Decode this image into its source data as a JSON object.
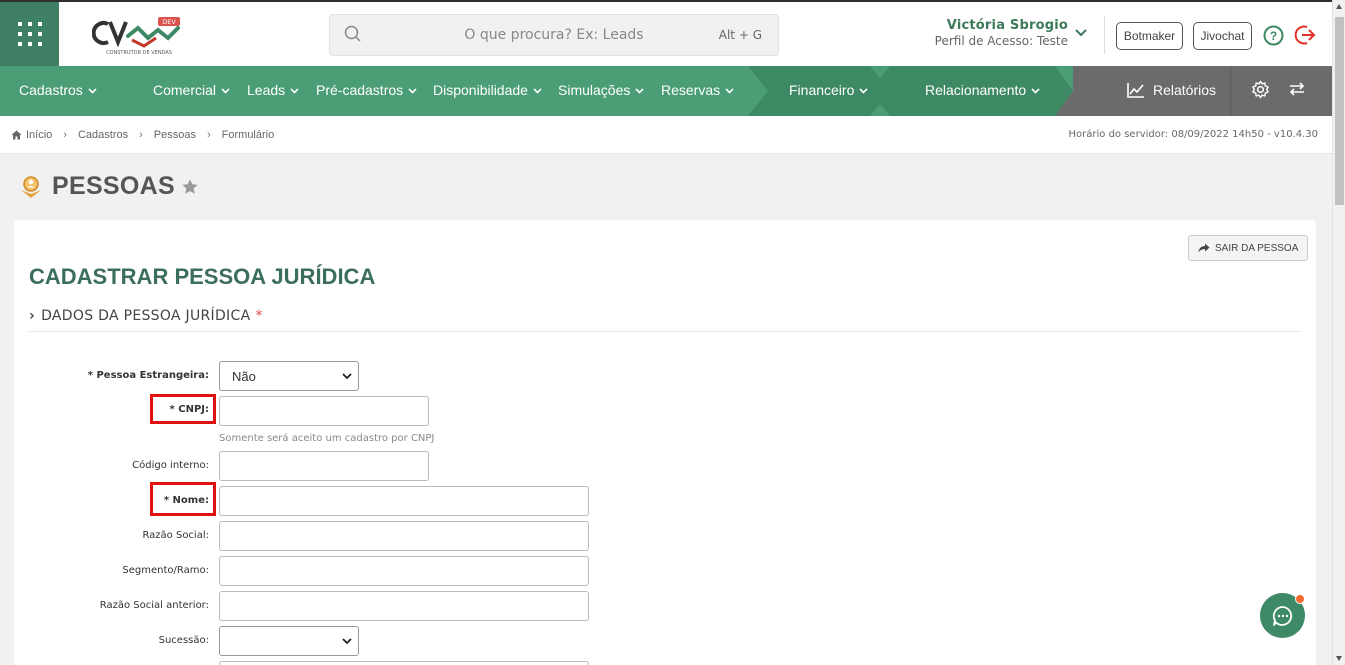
{
  "header": {
    "logo_text": "CV",
    "logo_badge": "DEV",
    "logo_tagline": "CONSTRUTOR DE VENDAS",
    "search_placeholder": "O que procura? Ex: Leads",
    "search_shortcut": "Alt + G",
    "user_name": "Victória Sbrogio",
    "user_profile": "Perfil de Acesso: Teste",
    "btn_botmaker": "Botmaker",
    "btn_jivochat": "Jivochat"
  },
  "nav": {
    "items": [
      {
        "label": "Cadastros"
      },
      {
        "label": "Comercial"
      },
      {
        "label": "Leads"
      },
      {
        "label": "Pré-cadastros"
      },
      {
        "label": "Disponibilidade"
      },
      {
        "label": "Simulações"
      },
      {
        "label": "Reservas"
      },
      {
        "label": "Financeiro"
      },
      {
        "label": "Relacionamento"
      }
    ],
    "reports": "Relatórios",
    "colors": {
      "green": "#4a9d75",
      "dark_green": "#3d8963",
      "gray": "#6b6b6b"
    }
  },
  "breadcrumb": {
    "items": [
      "Início",
      "Cadastros",
      "Pessoas",
      "Formulário"
    ],
    "server_time": "Horário do servidor: 08/09/2022 14h50 - v10.4.30"
  },
  "page": {
    "title": "PESSOAS",
    "exit_button": "SAIR DA PESSOA",
    "card_title": "CADASTRAR PESSOA JURÍDICA",
    "section_title": "DADOS DA PESSOA JURÍDICA",
    "section_required": "*"
  },
  "form": {
    "estrangeira_label": "* Pessoa Estrangeira:",
    "estrangeira_value": "Não",
    "cnpj_label": "* CNPJ:",
    "cnpj_hint": "Somente será aceito um cadastro por CNPJ",
    "codigo_label": "Código interno:",
    "nome_label": "* Nome:",
    "razao_label": "Razão Social:",
    "segmento_label": "Segmento/Ramo:",
    "razao_ant_label": "Razão Social anterior:",
    "sucessao_label": "Sucessão:",
    "sucessao_value": ""
  }
}
